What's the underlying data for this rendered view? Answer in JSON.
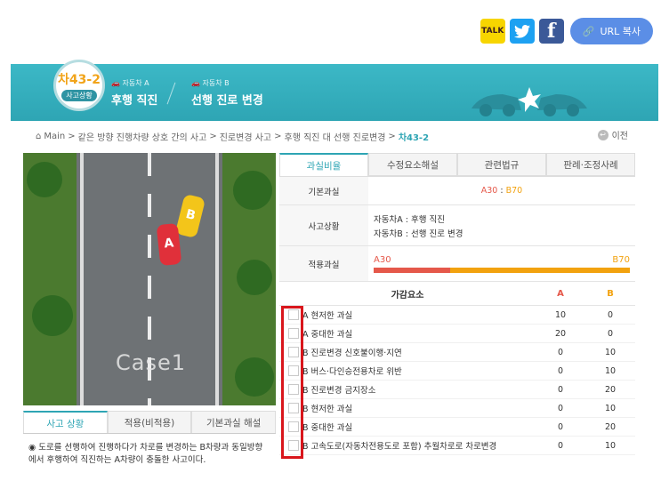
{
  "share": {
    "kakao_label": "TALK",
    "twitter_glyph": "🐦",
    "facebook_glyph": "f",
    "url_label": "URL 복사"
  },
  "banner": {
    "code": "차43-2",
    "badge_sub": "사고상황",
    "car_a_small": "🚗 자동차 A",
    "car_a_big": "후행 직진",
    "car_b_small": "🚗 자동차 B",
    "car_b_big": "선행 진로 변경"
  },
  "breadcrumb": {
    "home": "Main",
    "items": [
      "같은 방향 진행차량 상호 간의 사고",
      "진로변경 사고",
      "후행 직진 대 선행 진로변경"
    ],
    "current": "차43-2",
    "back_label": "이전"
  },
  "video": {
    "caption": "Case1",
    "car_a": "A",
    "car_b": "B"
  },
  "left_tabs": [
    "사고 상황",
    "적용(비적용)",
    "기본과실 해설"
  ],
  "description": "◉ 도로를 선행하여 진행하다가 차로를 변경하는 B차량과 동일방향에서 후행하여 직진하는 A차량이 충돌한 사고이다.",
  "right_tabs": [
    "과실비율",
    "수정요소해설",
    "관련법규",
    "판례·조정사례"
  ],
  "info": {
    "basic_label": "기본과실",
    "basic_a": "A30",
    "basic_sep": " : ",
    "basic_b": "B70",
    "situation_label": "사고상황",
    "situation_a": "자동차A : 후행 직진",
    "situation_b": "자동차B : 선행 진로 변경",
    "applied_label": "적용과실",
    "applied_a": "A30",
    "applied_b": "B70",
    "ratio_a": 30,
    "ratio_b": 70
  },
  "factors": {
    "header": "가감요소",
    "col_a": "A",
    "col_b": "B",
    "rows": [
      {
        "label": "A 현저한 과실",
        "a": "10",
        "b": "0"
      },
      {
        "label": "A 중대한 과실",
        "a": "20",
        "b": "0"
      },
      {
        "label": "B 진로변경 신호불이행·지연",
        "a": "0",
        "b": "10"
      },
      {
        "label": "B 버스·다인승전용차로 위반",
        "a": "0",
        "b": "10"
      },
      {
        "label": "B 진로변경 금지장소",
        "a": "0",
        "b": "20"
      },
      {
        "label": "B 현저한 과실",
        "a": "0",
        "b": "10"
      },
      {
        "label": "B 중대한 과실",
        "a": "0",
        "b": "20"
      },
      {
        "label": "B 고속도로(자동차전용도로 포함) 추월차로로 차로변경",
        "a": "0",
        "b": "10"
      }
    ]
  },
  "colors": {
    "accent": "#2ea5b4",
    "a": "#e5584a",
    "b": "#f2a20f",
    "highlight": "#d9161c"
  }
}
